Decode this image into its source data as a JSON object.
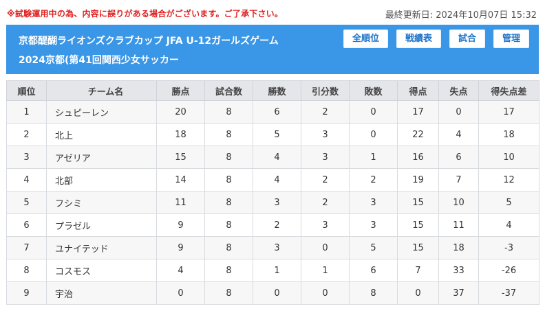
{
  "notice": "※試験運用中の為、内容に誤りがある場合がございます。ご了承下さい。",
  "last_updated": "最終更新日: 2024年10月07日 15:32",
  "header": {
    "title_line1": "京都醍醐ライオンズクラブカップ JFA U-12ガールズゲーム",
    "title_line2": "2024京都(第41回関西少女サッカー",
    "nav": [
      "全順位",
      "戦績表",
      "試合",
      "管理"
    ],
    "bg_color": "#3a96e6"
  },
  "table": {
    "columns": [
      "順位",
      "チーム名",
      "勝点",
      "試合数",
      "勝数",
      "引分数",
      "敗数",
      "得点",
      "失点",
      "得失点差"
    ],
    "rows": [
      [
        "1",
        "シュピーレン",
        "20",
        "8",
        "6",
        "2",
        "0",
        "17",
        "0",
        "17"
      ],
      [
        "2",
        "北上",
        "18",
        "8",
        "5",
        "3",
        "0",
        "22",
        "4",
        "18"
      ],
      [
        "3",
        "アゼリア",
        "15",
        "8",
        "4",
        "3",
        "1",
        "16",
        "6",
        "10"
      ],
      [
        "4",
        "北部",
        "14",
        "8",
        "4",
        "2",
        "2",
        "19",
        "7",
        "12"
      ],
      [
        "5",
        "フシミ",
        "11",
        "8",
        "3",
        "2",
        "3",
        "15",
        "10",
        "5"
      ],
      [
        "6",
        "プラゼル",
        "9",
        "8",
        "2",
        "3",
        "3",
        "15",
        "11",
        "4"
      ],
      [
        "7",
        "ユナイテッド",
        "9",
        "8",
        "3",
        "0",
        "5",
        "15",
        "18",
        "-3"
      ],
      [
        "8",
        "コスモス",
        "4",
        "8",
        "1",
        "1",
        "6",
        "7",
        "33",
        "-26"
      ],
      [
        "9",
        "宇治",
        "0",
        "8",
        "0",
        "0",
        "8",
        "0",
        "37",
        "-37"
      ]
    ]
  }
}
